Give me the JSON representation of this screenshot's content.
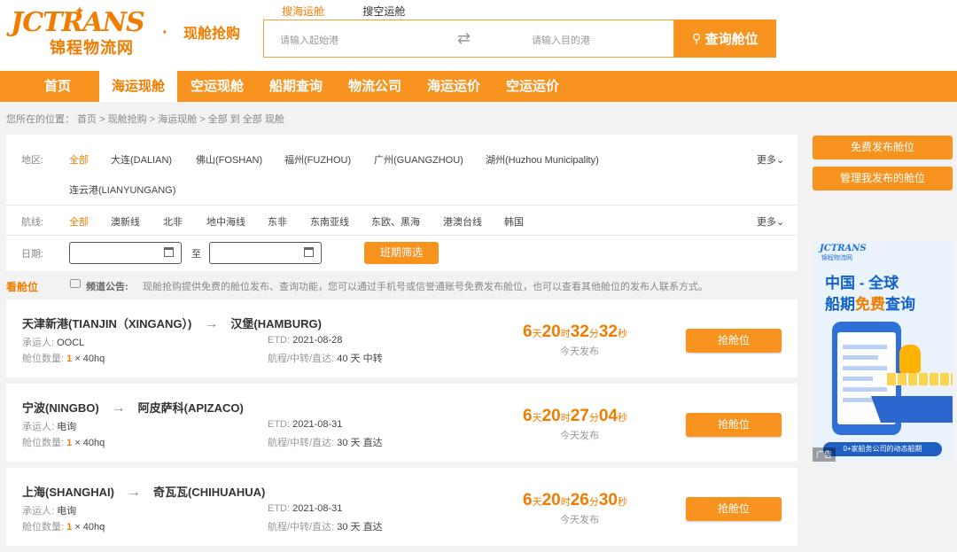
{
  "header": {
    "logo_en": "JCTRANS",
    "logo_cn": "锦程物流网",
    "dot": "·",
    "section_title": "现舱抢购",
    "search_tabs": [
      "搜海运舱",
      "搜空运舱"
    ],
    "origin_placeholder": "请输入起始港",
    "dest_placeholder": "请输入目的港",
    "search_button": "查询舱位"
  },
  "nav": {
    "items": [
      "首页",
      "海运现舱",
      "空运现舱",
      "船期查询",
      "物流公司",
      "海运运价",
      "空运运价"
    ],
    "active": "海运现舱"
  },
  "breadcrumb": "您所在的位置：  首页 > 现舱抢购 > 海运现舱 > 全部  到  全部  现舱",
  "filters": {
    "region_label": "地区:",
    "regions": [
      "全部",
      "大连(DALIAN)",
      "佛山(FOSHAN)",
      "福州(FUZHOU)",
      "广州(GUANGZHOU)",
      "湖州(Huzhou Municipality)",
      "连云港(LIANYUNGANG)"
    ],
    "route_label": "航线:",
    "routes": [
      "全部",
      "澳新线",
      "北非",
      "地中海线",
      "东非",
      "东南亚线",
      "东欧、黑海",
      "港澳台线",
      "韩国"
    ],
    "more": "更多",
    "date_label": "日期:",
    "to": "至",
    "filter_button": "班期筛选"
  },
  "notice": {
    "see": "看舱位",
    "announcement_label": "频道公告:",
    "text": "现舱抢购提供免费的舱位发布、查询功能，您可以通过手机号或信誉通账号免费发布舱位，也可以查看其他舱位的发布人联系方式。"
  },
  "labels": {
    "carrier": "承运人:",
    "quantity": "舱位数量:",
    "etd": "ETD:",
    "voyage": "航程/中转/直达:",
    "posted": "今天发布",
    "grab": "抢舱位",
    "day": "天",
    "hour": "时",
    "minute": "分",
    "second": "秒",
    "arrow": "→"
  },
  "listings": [
    {
      "from": "天津新港(TIANJIN（XINGANG）)",
      "to": "汉堡(HAMBURG)",
      "carrier": "OOCL",
      "qty": "1",
      "container": "× 40hq",
      "etd": "2021-08-28",
      "voyage": "40 天 中转",
      "d": "6",
      "h": "20",
      "m": "32",
      "s": "32"
    },
    {
      "from": "宁波(NINGBO)",
      "to": "阿皮萨科(APIZACO)",
      "carrier": "电询",
      "qty": "1",
      "container": "× 40hq",
      "etd": "2021-08-31",
      "voyage": "30 天 直达",
      "d": "6",
      "h": "20",
      "m": "27",
      "s": "04"
    },
    {
      "from": "上海(SHANGHAI)",
      "to": "奇瓦瓦(CHIHUAHUA)",
      "carrier": "电询",
      "qty": "1",
      "container": "× 40hq",
      "etd": "2021-08-31",
      "voyage": "30 天 直达",
      "d": "6",
      "h": "20",
      "m": "26",
      "s": "30"
    }
  ],
  "sidebar": {
    "publish_button": "免费发布舱位",
    "manage_button": "管理我发布的舱位",
    "ad_brand": "JCTRANS",
    "ad_brand_cn": "锦程物流网",
    "ad_line1": "中国 - 全球",
    "ad_line2_pre": "船期",
    "ad_line2_hl": "免费",
    "ad_line2_post": "查询",
    "ad_pill": "0+家船务公司的动态船期",
    "ad_tag": "广告"
  },
  "colors": {
    "accent": "#f7931e",
    "accent_text": "#f07d00",
    "ad_blue": "#0f62c7"
  }
}
